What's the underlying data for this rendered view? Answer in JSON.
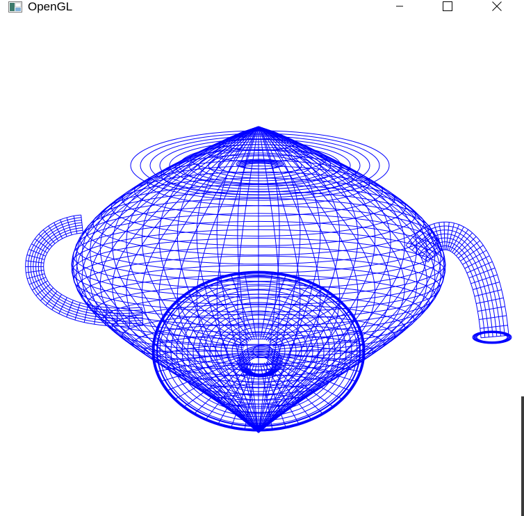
{
  "window": {
    "title": "OpenGL",
    "icon": "opengl-app-icon",
    "controls": {
      "minimize": "minimize-icon",
      "maximize": "maximize-icon",
      "close": "close-icon"
    }
  },
  "scene": {
    "object": "teapot",
    "render_mode": "wireframe",
    "wire_color": "#0000ff",
    "background_color": "#ffffff"
  }
}
